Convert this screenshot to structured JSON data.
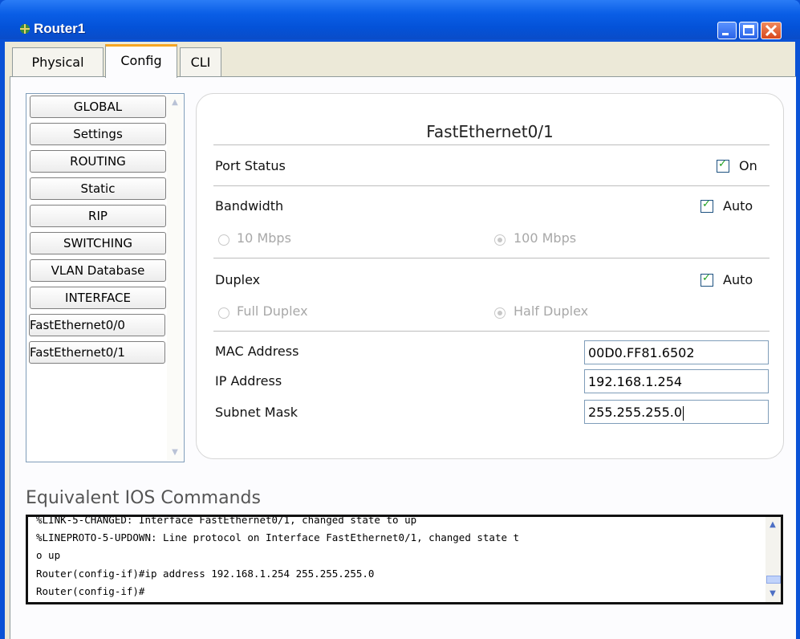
{
  "window": {
    "title": "Router1"
  },
  "tabs": [
    {
      "label": "Physical"
    },
    {
      "label": "Config",
      "active": true
    },
    {
      "label": "CLI"
    }
  ],
  "sidebar": {
    "items": [
      {
        "label": "GLOBAL"
      },
      {
        "label": "Settings"
      },
      {
        "label": "ROUTING"
      },
      {
        "label": "Static"
      },
      {
        "label": "RIP"
      },
      {
        "label": "SWITCHING"
      },
      {
        "label": "VLAN Database"
      },
      {
        "label": "INTERFACE"
      },
      {
        "label": "FastEthernet0/0"
      },
      {
        "label": "FastEthernet0/1"
      }
    ]
  },
  "interface": {
    "title": "FastEthernet0/1",
    "port_status": {
      "label": "Port Status",
      "checkbox_label": "On",
      "checked": true
    },
    "bandwidth": {
      "label": "Bandwidth",
      "checkbox_label": "Auto",
      "checked": true,
      "options": [
        "10 Mbps",
        "100 Mbps"
      ],
      "selected": "100 Mbps"
    },
    "duplex": {
      "label": "Duplex",
      "checkbox_label": "Auto",
      "checked": true,
      "options": [
        "Full Duplex",
        "Half Duplex"
      ],
      "selected": "Half Duplex"
    },
    "mac": {
      "label": "MAC Address",
      "value": "00D0.FF81.6502"
    },
    "ip": {
      "label": "IP Address",
      "value": "192.168.1.254"
    },
    "mask": {
      "label": "Subnet Mask",
      "value": "255.255.255.0"
    }
  },
  "ios": {
    "title": "Equivalent IOS Commands",
    "lines": [
      "%LINK-5-CHANGED: Interface FastEthernet0/1, changed state to up",
      "%LINEPROTO-5-UPDOWN: Line protocol on Interface FastEthernet0/1, changed state t",
      "o up",
      "Router(config-if)#ip address 192.168.1.254 255.255.255.0",
      "Router(config-if)#"
    ]
  },
  "colors": {
    "titlebar": "#0452d8",
    "accent_tab": "#f5a623",
    "checkmark": "#21a121"
  }
}
